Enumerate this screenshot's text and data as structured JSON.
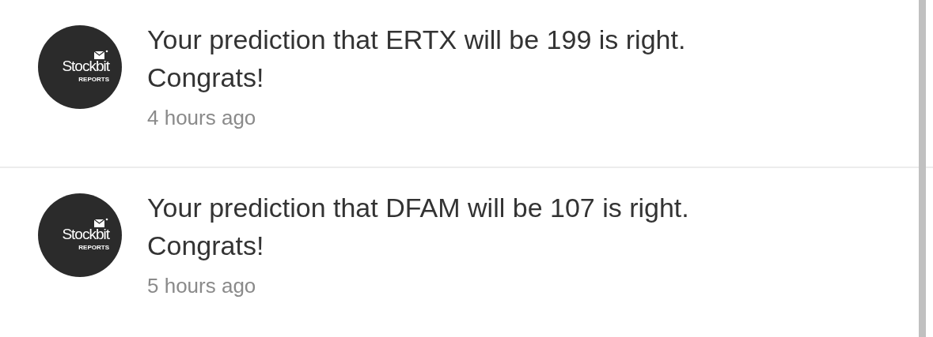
{
  "notifications": [
    {
      "avatar": {
        "brand": "Stockbit",
        "sub": "REPORTS"
      },
      "message": "Your prediction that ERTX will be 199 is right. Congrats!",
      "time": "4 hours ago"
    },
    {
      "avatar": {
        "brand": "Stockbit",
        "sub": "REPORTS"
      },
      "message": "Your prediction that DFAM will be 107 is right. Congrats!",
      "time": "5 hours ago"
    }
  ]
}
